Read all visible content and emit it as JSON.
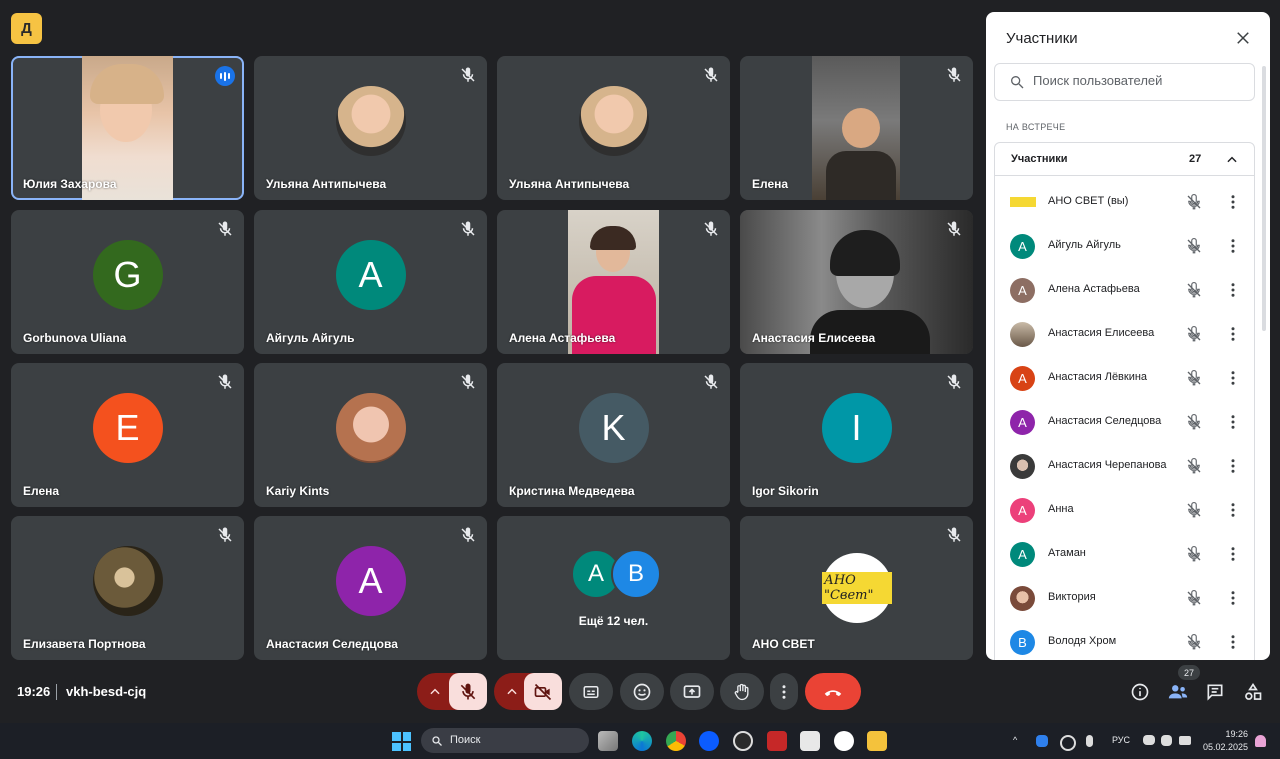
{
  "app": {
    "logo_glyph": "Д",
    "accent": "#8ab4f8",
    "tile_bg": "#3c4043"
  },
  "tiles": [
    {
      "name": "Юлия Захарова"
    },
    {
      "name": "Ульяна Антипычева"
    },
    {
      "name": "Ульяна Антипычева"
    },
    {
      "name": "Елена"
    },
    {
      "name": "Gorbunova Uliana",
      "initial": "G",
      "color": "#33691e"
    },
    {
      "name": "Айгуль Айгуль",
      "initial": "A",
      "color": "#00897b"
    },
    {
      "name": "Алена Астафьева"
    },
    {
      "name": "Анастасия Елисеева"
    },
    {
      "name": "Елена",
      "initial": "E",
      "color": "#f4511e"
    },
    {
      "name": "Kariy Kints"
    },
    {
      "name": "Кристина Медведева",
      "initial": "K",
      "color": "#455a64"
    },
    {
      "name": "Igor Sikorin",
      "initial": "I",
      "color": "#0097a7"
    },
    {
      "name": "Елизавета Портнова"
    },
    {
      "name": "Анастасия Селедцова",
      "initial": "A",
      "color": "#8e24aa"
    },
    {
      "name": "",
      "more_label": "Ещё 12 чел.",
      "more_avatars": [
        {
          "initial": "A",
          "color": "#00897b"
        },
        {
          "initial": "B",
          "color": "#1e88e5"
        }
      ]
    },
    {
      "name": "АНО СВЕТ",
      "logo_text": "АНО \"Свет\""
    }
  ],
  "panel": {
    "title": "Участники",
    "search_placeholder": "Поиск пользователей",
    "section_label": "НА ВСТРЕЧЕ",
    "group_title": "Участники",
    "group_count": "27",
    "participants": [
      {
        "name": "АНО СВЕТ (вы)",
        "initial": "",
        "color": "#f5d833",
        "logo": true
      },
      {
        "name": "Айгуль Айгуль",
        "initial": "A",
        "color": "#00897b"
      },
      {
        "name": "Алена Астафьева",
        "initial": "A",
        "color": "#8d6e63"
      },
      {
        "name": "Анастасия Елисеева",
        "initial": "",
        "color": "#7a6a5a",
        "photo": true
      },
      {
        "name": "Анастасия Лёвкина",
        "initial": "A",
        "color": "#d84315"
      },
      {
        "name": "Анастасия Селедцова",
        "initial": "A",
        "color": "#8e24aa"
      },
      {
        "name": "Анастасия Черепанова",
        "initial": "",
        "color": "#5d5d5d",
        "photo": true
      },
      {
        "name": "Анна",
        "initial": "A",
        "color": "#ec407a"
      },
      {
        "name": "Атаман",
        "initial": "A",
        "color": "#00897b"
      },
      {
        "name": "Виктория",
        "initial": "",
        "color": "#8d5b4c",
        "photo": true
      },
      {
        "name": "Володя Хром",
        "initial": "B",
        "color": "#1e88e5"
      }
    ]
  },
  "bottom": {
    "time": "19:26",
    "meeting_code": "vkh-besd-cjq",
    "participants_badge": "27"
  },
  "taskbar": {
    "search_label": "Поиск",
    "lang": "РУС",
    "time": "19:26",
    "date": "05.02.2025"
  }
}
